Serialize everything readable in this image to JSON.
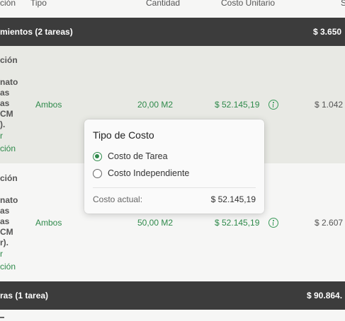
{
  "columns": {
    "descripcion": "ción",
    "tipo": "Tipo",
    "cantidad": "Cantidad",
    "costo_unitario": "Costo Unitario",
    "subtotal": "S"
  },
  "group1": {
    "label": "mientos (2 tareas)",
    "total": "$ 3.650"
  },
  "rows": [
    {
      "title": "ción",
      "desc": [
        "nato",
        "as",
        "as",
        "CM",
        ")."
      ],
      "link": [
        "r",
        "ción"
      ],
      "tipo": "Ambos",
      "cantidad": "20,00 M2",
      "costo_unitario": "$ 52.145,19",
      "subtotal": "$ 1.042"
    },
    {
      "title": "ción",
      "desc": [
        "nato",
        "as",
        "as",
        "CM",
        "r)."
      ],
      "link": [
        "r",
        "ción"
      ],
      "tipo": "Ambos",
      "cantidad": "50,00 M2",
      "costo_unitario": "$ 52.145,19",
      "subtotal": "$ 2.607"
    }
  ],
  "group2": {
    "label": "ras (1 tarea)",
    "total": "$ 90.864."
  },
  "popover": {
    "title": "Tipo de Costo",
    "options": [
      {
        "label": "Costo de Tarea",
        "selected": true
      },
      {
        "label": "Costo Independiente",
        "selected": false
      }
    ],
    "current_label": "Costo actual:",
    "current_value": "$ 52.145,19"
  },
  "colors": {
    "accent": "#2f8a4b",
    "group_bar": "#3c3c3c",
    "row_highlight": "#e8e9e4"
  },
  "icons": {
    "info": "info-icon"
  }
}
